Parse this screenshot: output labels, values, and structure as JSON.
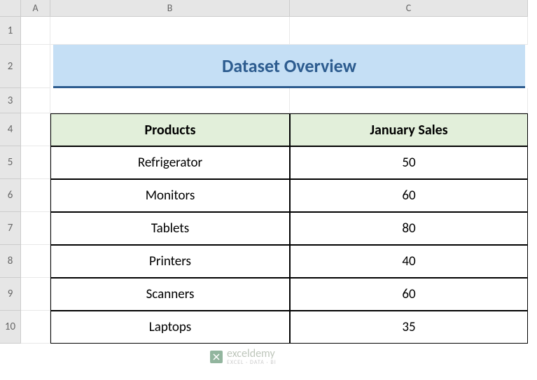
{
  "columns": [
    "A",
    "B",
    "C"
  ],
  "rows": [
    "1",
    "2",
    "3",
    "4",
    "5",
    "6",
    "7",
    "8",
    "9",
    "10"
  ],
  "title": "Dataset Overview",
  "table": {
    "headers": [
      "Products",
      "January Sales"
    ],
    "data": [
      {
        "product": "Refrigerator",
        "sales": "50"
      },
      {
        "product": "Monitors",
        "sales": "60"
      },
      {
        "product": "Tablets",
        "sales": "80"
      },
      {
        "product": "Printers",
        "sales": "40"
      },
      {
        "product": "Scanners",
        "sales": "60"
      },
      {
        "product": "Laptops",
        "sales": "35"
      }
    ]
  },
  "watermark": {
    "name": "exceldemy",
    "tagline": "EXCEL · DATA · BI"
  },
  "chart_data": {
    "type": "table",
    "title": "Dataset Overview",
    "columns": [
      "Products",
      "January Sales"
    ],
    "rows": [
      [
        "Refrigerator",
        50
      ],
      [
        "Monitors",
        60
      ],
      [
        "Tablets",
        80
      ],
      [
        "Printers",
        40
      ],
      [
        "Scanners",
        60
      ],
      [
        "Laptops",
        35
      ]
    ]
  }
}
